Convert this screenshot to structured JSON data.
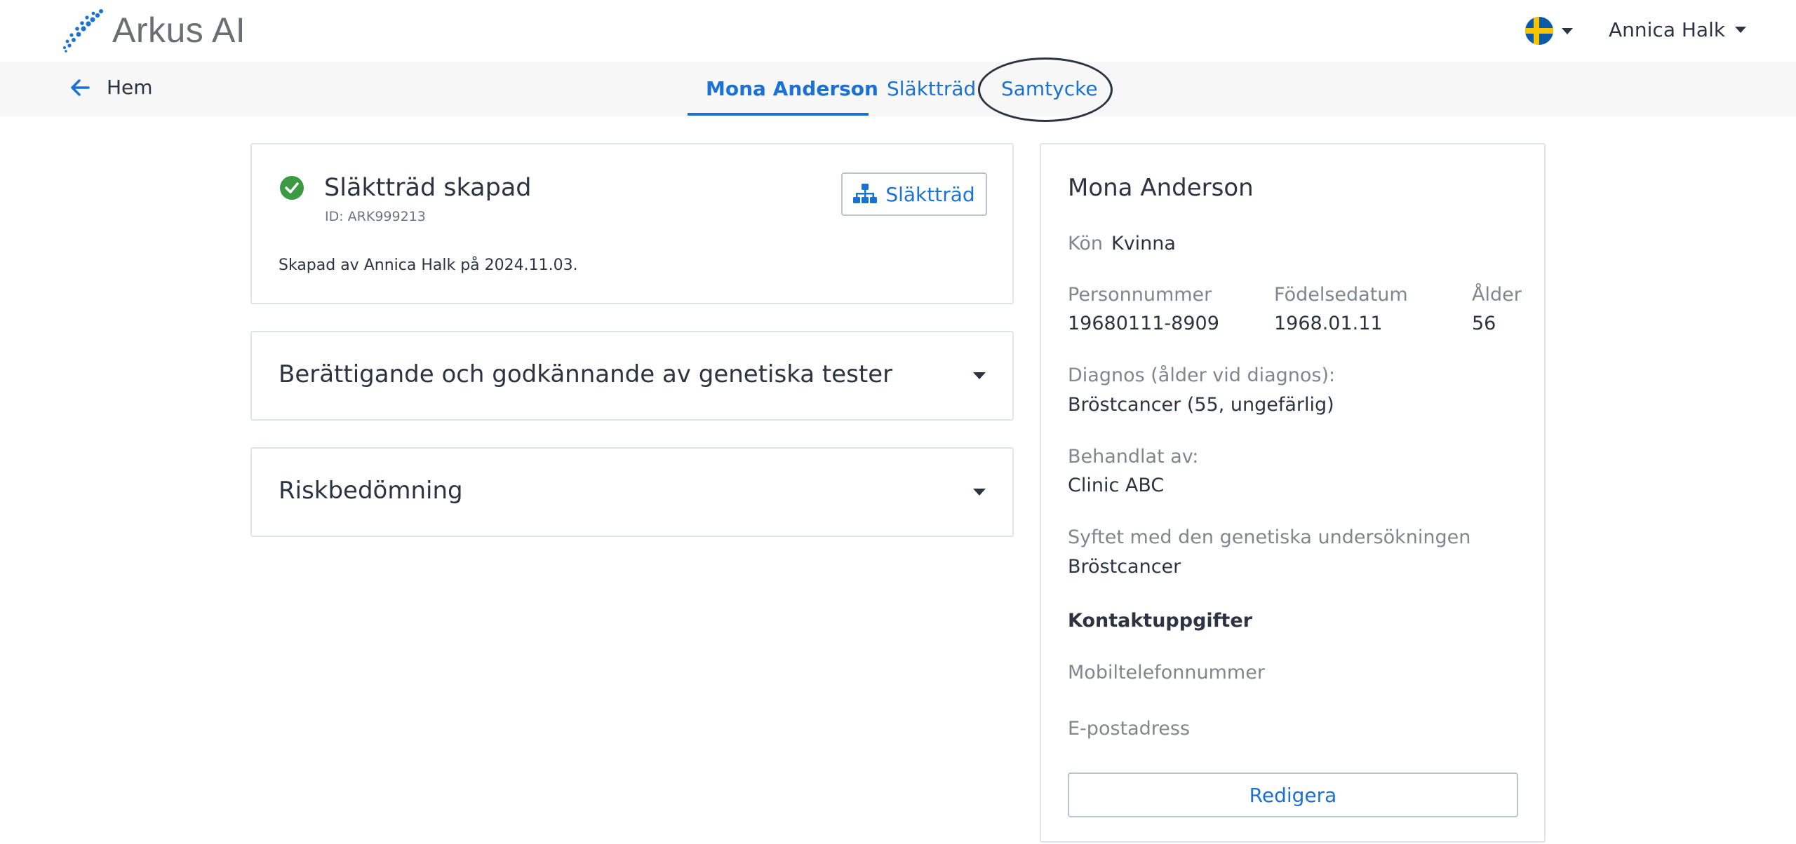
{
  "header": {
    "app_name": "Arkus AI",
    "language_icon": "sweden-flag-icon",
    "user_name": "Annica Halk"
  },
  "subnav": {
    "back_label": "Hem",
    "tabs": [
      {
        "label": "Mona Anderson",
        "active": true
      },
      {
        "label": "Släktträd",
        "active": false
      },
      {
        "label": "Samtycke",
        "active": false
      }
    ]
  },
  "family_tree_card": {
    "title": "Släktträd skapad",
    "id_text": "ID: ARK999213",
    "created_text": "Skapad av Annica Halk på 2024.11.03.",
    "button_label": "Släktträd"
  },
  "accordions": [
    {
      "title": "Berättigande och godkännande av genetiska tester"
    },
    {
      "title": "Riskbedömning"
    }
  ],
  "patient": {
    "name": "Mona Anderson",
    "gender_label": "Kön",
    "gender_value": "Kvinna",
    "personnummer_label": "Personnummer",
    "personnummer_value": "19680111-8909",
    "birthdate_label": "Födelsedatum",
    "birthdate_value": "1968.01.11",
    "age_label": "Ålder",
    "age_value": "56",
    "diagnosis_label": "Diagnos (ålder vid diagnos):",
    "diagnosis_value": "Bröstcancer (55, ungefärlig)",
    "treated_by_label": "Behandlat av:",
    "treated_by_value": "Clinic ABC",
    "purpose_label": "Syftet med den genetiska undersökningen",
    "purpose_value": "Bröstcancer",
    "contact_heading": "Kontaktuppgifter",
    "mobile_label": "Mobiltelefonnummer",
    "email_label": "E-postadress",
    "edit_button": "Redigera"
  },
  "colors": {
    "accent": "#1a72d4",
    "success": "#3c9a45",
    "text": "#2b3440",
    "muted": "#80868c"
  }
}
